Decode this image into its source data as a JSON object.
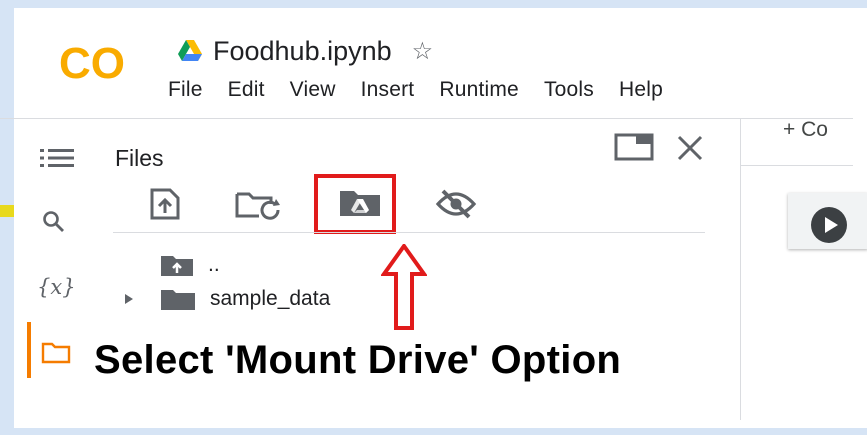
{
  "app": {
    "logo_text": "CO",
    "brand_color": "#f9ab00"
  },
  "notebook": {
    "title": "Foodhub.ipynb",
    "star_icon": "star-icon",
    "drive_icon": "google-drive-icon"
  },
  "menu": [
    "File",
    "Edit",
    "View",
    "Insert",
    "Runtime",
    "Tools",
    "Help"
  ],
  "sidebar": {
    "items": [
      {
        "icon": "table-of-contents-icon"
      },
      {
        "icon": "search-icon"
      },
      {
        "label": "{x}",
        "icon": "variables-icon"
      },
      {
        "icon": "folder-icon",
        "active": true
      }
    ]
  },
  "files_panel": {
    "title": "Files",
    "toolbar": [
      {
        "icon": "upload-file-icon"
      },
      {
        "icon": "refresh-folder-icon"
      },
      {
        "icon": "mount-drive-icon",
        "highlighted": true
      },
      {
        "icon": "hide-files-icon"
      }
    ],
    "tree": [
      {
        "label": "..",
        "icon": "parent-folder-icon"
      },
      {
        "label": "sample_data",
        "icon": "folder-icon"
      }
    ]
  },
  "main": {
    "add_code_label": "+ Co"
  },
  "annotation": {
    "caption": "Select 'Mount Drive' Option",
    "highlight_color": "#e11b1b"
  }
}
